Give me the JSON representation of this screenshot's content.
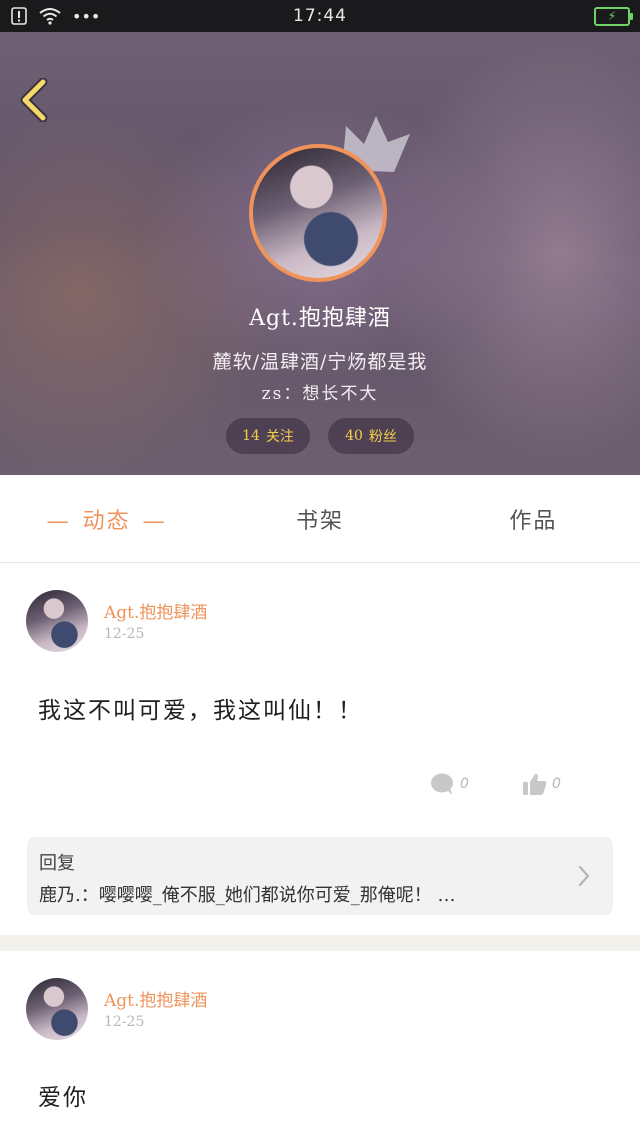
{
  "status_bar": {
    "time": "17:44",
    "icons": [
      "sim-alert-icon",
      "wifi-icon",
      "more-dots-icon",
      "battery-charging-icon"
    ],
    "dots": "•••"
  },
  "profile": {
    "username": "Agt.抱抱肆酒",
    "bio_line1": "麓软/温肆酒/宁炀都是我",
    "bio_line2": "zs：想长不大",
    "following_count": "14",
    "following_label": "关注",
    "followers_count": "40",
    "followers_label": "粉丝",
    "accent_color": "#f0935a",
    "stat_color": "#f3cf4a"
  },
  "tabs": {
    "active": "动态",
    "dash": "—",
    "bookshelf": "书架",
    "works": "作品"
  },
  "posts": [
    {
      "author": "Agt.抱抱肆酒",
      "date": "12-25",
      "content": "我这不叫可爱，我这叫仙！！",
      "comment_count": "0",
      "like_count": "0",
      "reply": {
        "title": "回复",
        "text": "鹿乃.：嘤嘤嘤_俺不服_她们都说你可爱_那俺呢！ …"
      }
    },
    {
      "author": "Agt.抱抱肆酒",
      "date": "12-25",
      "content": "爱你"
    }
  ]
}
